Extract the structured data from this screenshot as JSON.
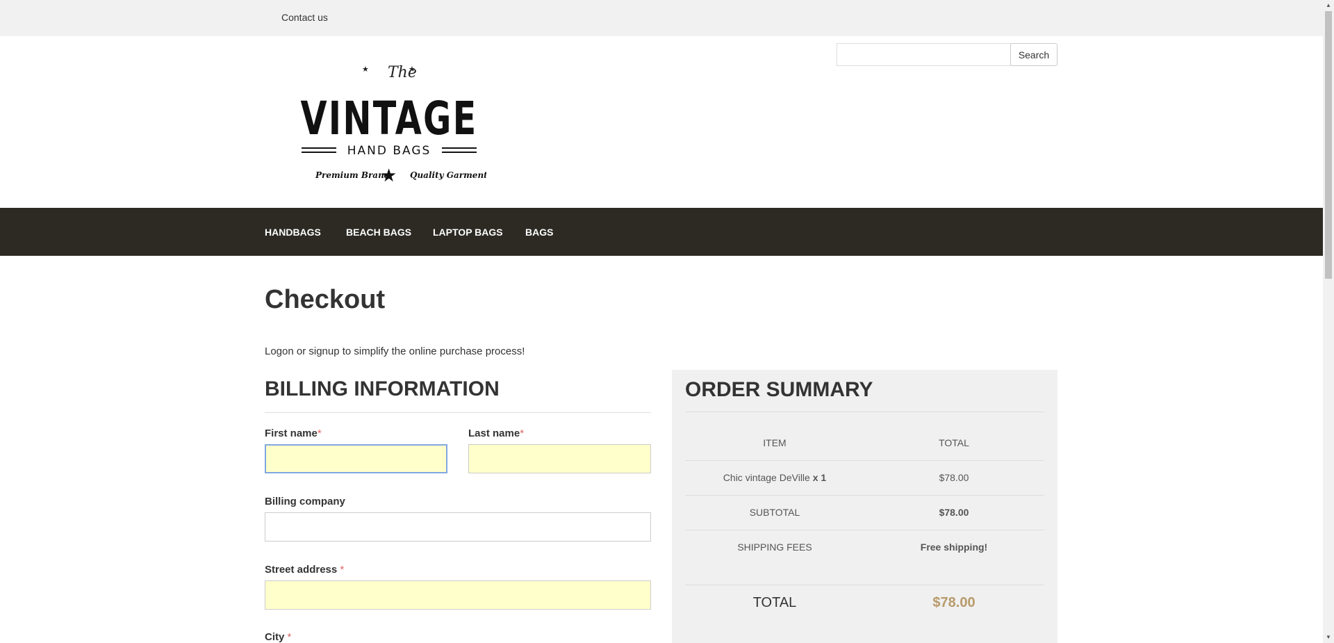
{
  "topbar": {
    "contact": "Contact us"
  },
  "search": {
    "button": "Search",
    "placeholder": ""
  },
  "logo": {
    "the": "The",
    "vintage": "VINTAGE",
    "handbags": "HAND BAGS",
    "premium": "Premium Brand",
    "quality": "Quality Garments"
  },
  "nav": {
    "items": [
      "HANDBAGS",
      "BEACH BAGS",
      "LAPTOP BAGS",
      "BAGS"
    ]
  },
  "page": {
    "title": "Checkout",
    "intro": "Logon or signup to simplify the online purchase process!"
  },
  "billing": {
    "title": "BILLING INFORMATION",
    "first_name": "First name",
    "last_name": "Last name",
    "company": "Billing company",
    "street": "Street address",
    "city": "City",
    "required_mark": "*"
  },
  "summary": {
    "title": "ORDER SUMMARY",
    "col_item": "ITEM",
    "col_total": "TOTAL",
    "item_name": "Chic vintage DeVille",
    "item_qty": "x 1",
    "item_price": "$78.00",
    "subtotal_label": "SUBTOTAL",
    "subtotal_value": "$78.00",
    "shipping_label": "SHIPPING FEES",
    "shipping_value": "Free shipping!",
    "total_label": "TOTAL",
    "total_value": "$78.00"
  },
  "colors": {
    "nav_bg": "#2c2a23",
    "required_bg": "#ffffcc",
    "total_accent": "#b89a6a"
  }
}
